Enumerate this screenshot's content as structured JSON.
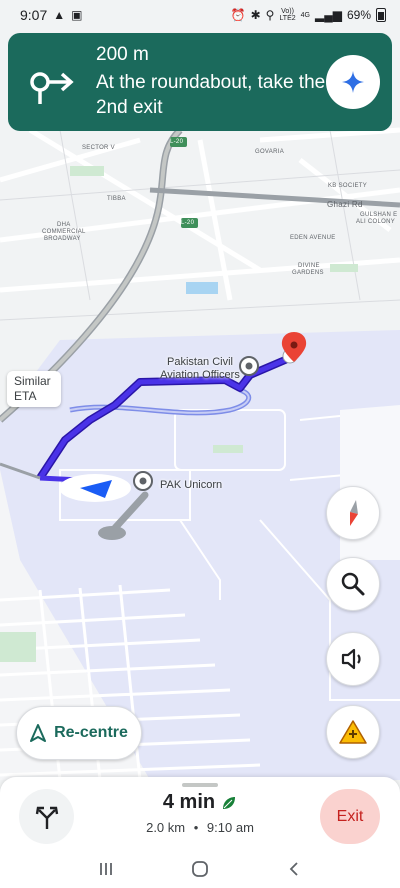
{
  "status_bar": {
    "time": "9:07",
    "network_top": "Vo))",
    "network_bottom": "LTE2",
    "signal_type": "4G",
    "battery": "69%"
  },
  "navigation": {
    "distance": "200 m",
    "instruction": "At the roundabout, take the 2nd exit",
    "turn_icon": "roundabout-exit-icon",
    "assistant_icon": "gemini-sparkle-icon"
  },
  "map": {
    "labels": {
      "sector_v": "SECTOR V",
      "govaria": "GOVARIA",
      "tibba": "TIBBA",
      "kb_society": "KB SOCIETY",
      "ghazi_rd": "Ghazi Rd",
      "gulshan": "GULSHAN E",
      "ali_colony": "ALI COLONY",
      "dha": "DHA",
      "commercial": "COMMERCIAL",
      "broadway": "BROADWAY",
      "eden_avenue": "EDEN AVENUE",
      "divine": "DIVINE",
      "gardens": "GARDENS",
      "l20_a": "L-20",
      "l20_b": "L-20"
    },
    "similar_eta": "Similar ETA",
    "poi_civil_aviation": "Pakistan Civil Aviation Officers",
    "poi_pak_unicorn": "PAK Unicorn",
    "colors": {
      "route": "#3c1fd6",
      "route_alt": "#7e8de8",
      "airport_area": "#e3e6f8",
      "road": "#ffffff",
      "destination_pin": "#ea4335"
    }
  },
  "controls": {
    "compass_icon": "compass-icon",
    "search_icon": "search-icon",
    "sound_icon": "volume-icon",
    "report_icon": "report-incident-icon",
    "recentre_label": "Re-centre"
  },
  "trip": {
    "duration": "4 min",
    "distance": "2.0 km",
    "separator": "•",
    "arrival_time": "9:10 am",
    "exit_label": "Exit"
  },
  "android_nav": {
    "recents_icon": "recents-icon",
    "home_icon": "home-icon",
    "back_icon": "back-icon"
  }
}
